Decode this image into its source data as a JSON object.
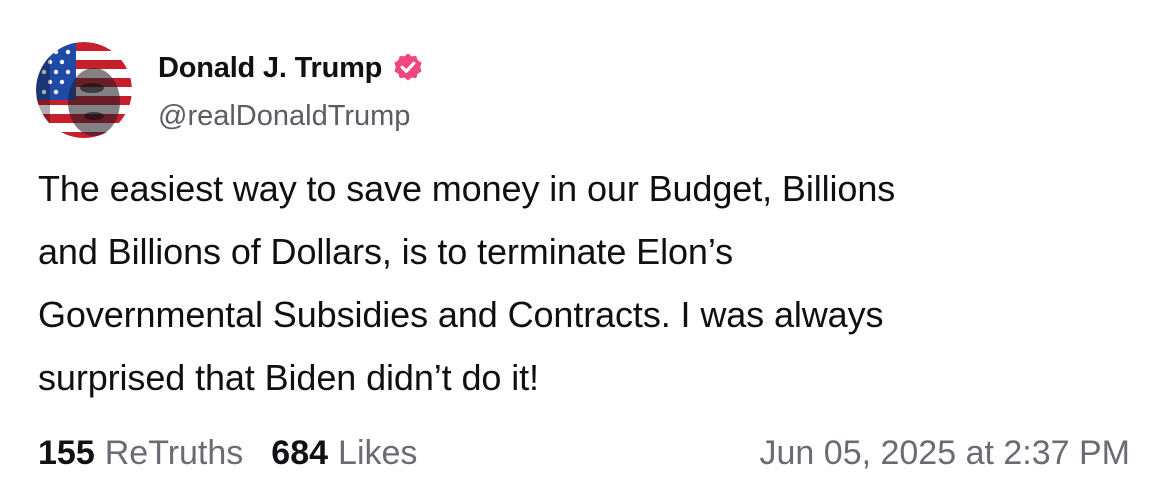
{
  "author": {
    "display_name": "Donald J. Trump",
    "handle": "@realDonaldTrump",
    "verified": true,
    "verified_color": "#f0487d"
  },
  "post": {
    "lines": [
      "The easiest way to save money in our Budget, Billions",
      "and Billions of Dollars, is to terminate Elon’s",
      "Governmental Subsidies and Contracts. I was always",
      "surprised that Biden didn’t do it!"
    ]
  },
  "stats": {
    "retruths_count": "155",
    "retruths_label": "ReTruths",
    "likes_count": "684",
    "likes_label": "Likes"
  },
  "timestamp": "Jun 05, 2025 at 2:37 PM",
  "icons": {
    "avatar": "flag-portrait-avatar",
    "verified": "verified-badge-icon"
  }
}
